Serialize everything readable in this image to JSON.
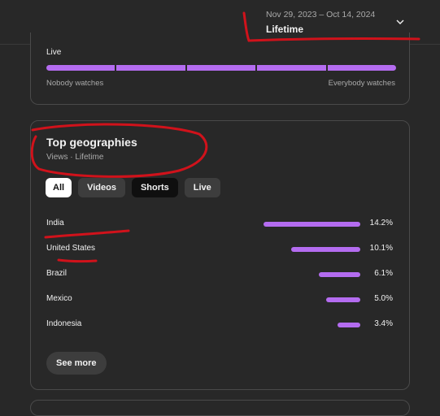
{
  "header": {
    "date_range": "Nov 29, 2023 – Oct 14, 2024",
    "period": "Lifetime",
    "chevron_icon": "chevron-down-icon"
  },
  "live_card": {
    "title": "Live",
    "left_label": "Nobody watches",
    "right_label": "Everybody watches",
    "bar_color": "#b46cf0"
  },
  "geographies": {
    "title": "Top geographies",
    "subtitle": "Views · Lifetime",
    "chips": [
      {
        "label": "All",
        "selected": true
      },
      {
        "label": "Videos",
        "selected": false
      },
      {
        "label": "Shorts",
        "selected": false
      },
      {
        "label": "Live",
        "selected": false
      }
    ],
    "rows": [
      {
        "country": "India",
        "value": "14.2%",
        "percent": 14.2
      },
      {
        "country": "United States",
        "value": "10.1%",
        "percent": 10.1
      },
      {
        "country": "Brazil",
        "value": "6.1%",
        "percent": 6.1
      },
      {
        "country": "Mexico",
        "value": "5.0%",
        "percent": 5.0
      },
      {
        "country": "Indonesia",
        "value": "3.4%",
        "percent": 3.4
      }
    ],
    "see_more": "See more"
  },
  "colors": {
    "background": "#282828",
    "accent": "#b46cf0",
    "annotation": "#d0121b"
  }
}
